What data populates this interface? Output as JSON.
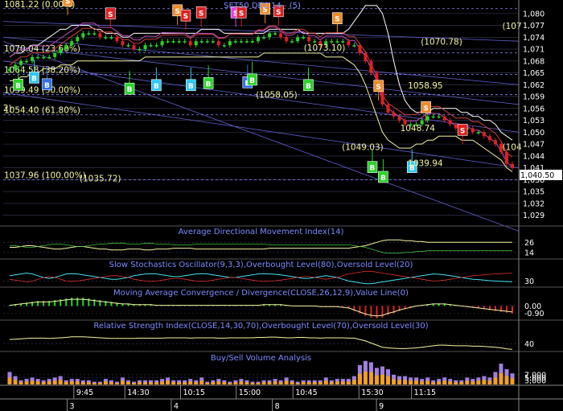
{
  "chart_data": {
    "type": "candlestick",
    "header": "SET50 DEC 14 - (5)",
    "last_price": "1,040.50",
    "price_ylim": [
      1026.5,
      1083
    ],
    "y_ticks": [
      "1,080",
      "1,077",
      "1,074",
      "1,071",
      "1,068",
      "1,065",
      "1,062",
      "1,059",
      "1,056",
      "1,053",
      "1,050",
      "1,047",
      "1,044",
      "1,041",
      "1,038",
      "1,035",
      "1,032",
      "1,029"
    ],
    "fib_levels": [
      {
        "label": "1081.22 (0.00%)",
        "value": 1081.22
      },
      {
        "label": "1070.04 (23.60%)",
        "value": 1070.04
      },
      {
        "label": "1064.58 (38.20%)",
        "value": 1064.58
      },
      {
        "label": "1059.49 (50.00%)",
        "value": 1059.49
      },
      {
        "label": "1054.40 (61.80%)",
        "value": 1054.4
      },
      {
        "label": "1037.96 (100.00%)",
        "value": 1037.96
      }
    ],
    "price_annotations": [
      {
        "label": "(1073.10)",
        "x": 0.583,
        "value": 1070.6
      },
      {
        "label": "(1070.78)",
        "x": 0.81,
        "value": 1072.1
      },
      {
        "label": "1058.95",
        "x": 0.785,
        "value": 1061.0
      },
      {
        "label": "(1058.05)",
        "x": 0.49,
        "value": 1058.7
      },
      {
        "label": "1048.74",
        "x": 0.77,
        "value": 1050.3
      },
      {
        "label": "(1049.03)",
        "x": 0.657,
        "value": 1045.5
      },
      {
        "label": "1039.94",
        "x": 0.785,
        "value": 1041.4
      },
      {
        "label": "(1035.72)",
        "x": 0.148,
        "value": 1037.6
      },
      {
        "label": "(104",
        "x": 0.968,
        "value": 1045.5
      },
      {
        "label": "(107",
        "x": 0.968,
        "value": 1076.1
      },
      {
        "label": "2)",
        "x": 0.0,
        "value": 1055.4
      }
    ],
    "signals": [
      {
        "t": "S",
        "x": 0.125,
        "value": 1083.3,
        "color": "#f08c28"
      },
      {
        "t": "S",
        "x": 0.208,
        "value": 1080.0,
        "color": "#e02020"
      },
      {
        "t": "S",
        "x": 0.338,
        "value": 1080.8,
        "color": "#f08c28"
      },
      {
        "t": "S",
        "x": 0.354,
        "value": 1079.5,
        "color": "#e02020"
      },
      {
        "t": "S",
        "x": 0.384,
        "value": 1080.3,
        "color": "#e02020"
      },
      {
        "t": "S",
        "x": 0.451,
        "value": 1080.3,
        "color": "#e040e0"
      },
      {
        "t": "S",
        "x": 0.462,
        "value": 1080.3,
        "color": "#e02020"
      },
      {
        "t": "S",
        "x": 0.508,
        "value": 1081.2,
        "color": "#f08c28"
      },
      {
        "t": "S",
        "x": 0.534,
        "value": 1080.6,
        "color": "#e02020"
      },
      {
        "t": "S",
        "x": 0.648,
        "value": 1078.8,
        "color": "#f08c28"
      },
      {
        "t": "S",
        "x": 0.728,
        "value": 1061.7,
        "color": "#f08c28"
      },
      {
        "t": "S",
        "x": 0.82,
        "value": 1056.3,
        "color": "#f08c28"
      },
      {
        "t": "S",
        "x": 0.891,
        "value": 1050.6,
        "color": "#e02020"
      },
      {
        "t": "B",
        "x": 0.029,
        "value": 1062.0,
        "color": "#28d428"
      },
      {
        "t": "B",
        "x": 0.06,
        "value": 1063.8,
        "color": "#2ec8f0"
      },
      {
        "t": "B",
        "x": 0.085,
        "value": 1062.1,
        "color": "#2e70e8"
      },
      {
        "t": "B",
        "x": 0.245,
        "value": 1061.0,
        "color": "#28d428"
      },
      {
        "t": "B",
        "x": 0.297,
        "value": 1061.9,
        "color": "#2ec8f0"
      },
      {
        "t": "B",
        "x": 0.364,
        "value": 1061.9,
        "color": "#2ec8f0"
      },
      {
        "t": "B",
        "x": 0.398,
        "value": 1062.4,
        "color": "#28d428"
      },
      {
        "t": "B",
        "x": 0.474,
        "value": 1062.6,
        "color": "#2e70e8"
      },
      {
        "t": "B",
        "x": 0.483,
        "value": 1063.3,
        "color": "#28d428"
      },
      {
        "t": "B",
        "x": 0.592,
        "value": 1061.9,
        "color": "#28d428"
      },
      {
        "t": "B",
        "x": 0.716,
        "value": 1041.2,
        "color": "#28d428"
      },
      {
        "t": "B",
        "x": 0.737,
        "value": 1038.7,
        "color": "#28d428"
      },
      {
        "t": "B",
        "x": 0.793,
        "value": 1041.2,
        "color": "#2ec8f0"
      }
    ],
    "close_series": [
      1066,
      1067,
      1068,
      1068,
      1069,
      1069,
      1069,
      1069,
      1070,
      1071,
      1072,
      1073,
      1074,
      1075,
      1075,
      1075,
      1074,
      1074,
      1074,
      1073,
      1072,
      1072,
      1071,
      1071,
      1072,
      1072,
      1072,
      1073,
      1073,
      1073,
      1073,
      1073,
      1072,
      1073,
      1073,
      1073,
      1073,
      1072,
      1072,
      1073,
      1073,
      1073,
      1073,
      1073,
      1074,
      1074,
      1075,
      1075,
      1074,
      1073,
      1073,
      1074,
      1074,
      1073,
      1073,
      1072,
      1073,
      1073,
      1073,
      1073,
      1072,
      1072,
      1070,
      1068,
      1065,
      1062,
      1057,
      1055,
      1054,
      1053,
      1052,
      1052,
      1052,
      1053,
      1054,
      1054,
      1054,
      1053,
      1052,
      1051,
      1051,
      1051,
      1050,
      1050,
      1049,
      1048,
      1047,
      1045,
      1042,
      1041
    ],
    "fast_band": [
      1069,
      1070,
      1070,
      1071,
      1072,
      1072,
      1073,
      1074,
      1075,
      1076,
      1076,
      1077,
      1077,
      1077,
      1077,
      1076,
      1076,
      1075,
      1075,
      1075,
      1074,
      1074,
      1075,
      1075,
      1075,
      1075,
      1075,
      1075,
      1075,
      1075,
      1075,
      1075,
      1075,
      1075,
      1076,
      1076,
      1076,
      1076,
      1075,
      1075,
      1075,
      1075,
      1075,
      1075,
      1075,
      1075,
      1076,
      1076,
      1076,
      1076,
      1076,
      1076,
      1075,
      1075,
      1075,
      1075,
      1075,
      1075,
      1075,
      1075,
      1076,
      1078,
      1080,
      1082,
      1082,
      1082,
      1080,
      1075,
      1068,
      1062,
      1058,
      1056,
      1055,
      1055,
      1055,
      1056,
      1056,
      1056,
      1056,
      1056,
      1055,
      1055,
      1054,
      1054,
      1053,
      1053,
      1052,
      1050,
      1049,
      1048
    ],
    "slow_band": [
      1063,
      1063,
      1064,
      1064,
      1065,
      1065,
      1066,
      1066,
      1066,
      1067,
      1067,
      1067,
      1068,
      1068,
      1068,
      1068,
      1068,
      1068,
      1068,
      1068,
      1068,
      1068,
      1068,
      1068,
      1069,
      1069,
      1069,
      1069,
      1069,
      1069,
      1069,
      1069,
      1069,
      1069,
      1069,
      1069,
      1069,
      1069,
      1069,
      1069,
      1069,
      1069,
      1069,
      1069,
      1069,
      1070,
      1070,
      1070,
      1070,
      1070,
      1070,
      1070,
      1070,
      1070,
      1070,
      1070,
      1069,
      1069,
      1069,
      1069,
      1068,
      1067,
      1065,
      1062,
      1058,
      1054,
      1050,
      1048,
      1047,
      1046,
      1046,
      1046,
      1047,
      1047,
      1048,
      1048,
      1049,
      1049,
      1049,
      1049,
      1048,
      1048,
      1048,
      1047,
      1046,
      1045,
      1044,
      1043,
      1041,
      1040
    ],
    "indicator_titles": [
      "Average Directional Movement Index(14)",
      "Slow Stochastics Oscillator(9,3,3),Overbought Level(80),Oversold Level(20)",
      "Moving Average Convergence / Divergence(CLOSE,26,12,9),Value Line(0)",
      "Relative Strength Index(CLOSE,14,30,70),Overbought Level(70),Oversold Level(30)",
      "Buy/Sell Volume Analysis"
    ],
    "adx_ticks": [
      "26",
      "14"
    ],
    "stoch_ticks": [
      "30"
    ],
    "macd_ticks": [
      "0.00",
      "-0.90"
    ],
    "rsi_ticks": [
      "40"
    ],
    "volume_ticks": [
      "7,000",
      "5,000",
      "3,000"
    ],
    "adx": [
      20,
      20,
      21,
      22,
      22,
      21,
      20,
      19,
      18,
      18,
      19,
      20,
      21,
      21,
      20,
      19,
      18,
      18,
      17,
      17,
      17,
      18,
      18,
      18,
      17,
      17,
      18,
      18,
      18,
      19,
      19,
      19,
      19,
      18,
      18,
      18,
      18,
      18,
      18,
      18,
      18,
      18,
      18,
      18,
      18,
      18,
      19,
      19,
      19,
      19,
      19,
      19,
      19,
      19,
      19,
      19,
      19,
      19,
      19,
      19,
      19,
      20,
      21,
      22,
      24,
      26,
      28,
      29,
      29,
      29,
      28,
      28,
      27,
      27,
      26,
      26,
      26,
      26,
      26,
      26,
      26,
      26,
      26,
      26,
      26,
      26,
      26,
      26,
      26,
      26
    ],
    "stoch_k": [
      60,
      65,
      70,
      75,
      70,
      60,
      50,
      45,
      50,
      60,
      70,
      72,
      70,
      65,
      60,
      55,
      50,
      45,
      40,
      40,
      45,
      50,
      60,
      65,
      70,
      72,
      70,
      65,
      60,
      55,
      55,
      60,
      65,
      70,
      72,
      70,
      65,
      60,
      55,
      50,
      50,
      55,
      60,
      65,
      70,
      72,
      70,
      68,
      65,
      60,
      55,
      50,
      45,
      45,
      50,
      55,
      60,
      55,
      50,
      40,
      30,
      25,
      20,
      15,
      15,
      20,
      25,
      30,
      35,
      40,
      45,
      50,
      55,
      60,
      65,
      70,
      68,
      65,
      60,
      55,
      50,
      45,
      40,
      38,
      35,
      32,
      30,
      28,
      27,
      26
    ],
    "macd_hist": [
      0.1,
      0.2,
      0.3,
      0.4,
      0.5,
      0.6,
      0.6,
      0.6,
      0.7,
      0.8,
      0.9,
      1.0,
      1.0,
      1.0,
      0.9,
      0.8,
      0.7,
      0.6,
      0.5,
      0.4,
      0.3,
      0.3,
      0.2,
      0.2,
      0.2,
      0.2,
      0.1,
      0.1,
      0.1,
      0.1,
      0.1,
      0.1,
      0.1,
      0.1,
      0.1,
      0.1,
      0.1,
      0.1,
      0.1,
      0.1,
      0.1,
      0.1,
      0.1,
      0.1,
      0.1,
      0.2,
      0.2,
      0.2,
      0.2,
      0.1,
      0.0,
      0.0,
      0.0,
      0.0,
      0.0,
      -0.1,
      -0.1,
      -0.1,
      -0.1,
      -0.2,
      -0.3,
      -0.6,
      -0.9,
      -1.2,
      -1.4,
      -1.5,
      -1.4,
      -1.1,
      -0.9,
      -0.6,
      -0.4,
      -0.2,
      0.0,
      0.1,
      0.2,
      0.3,
      0.3,
      0.3,
      0.2,
      0.1,
      0.0,
      -0.1,
      -0.2,
      -0.3,
      -0.4,
      -0.5,
      -0.6,
      -0.7,
      -0.8,
      -0.9
    ],
    "rsi": [
      52,
      53,
      54,
      55,
      56,
      56,
      56,
      55,
      56,
      57,
      58,
      60,
      60,
      60,
      59,
      58,
      57,
      56,
      55,
      55,
      55,
      55,
      55,
      56,
      56,
      56,
      56,
      56,
      57,
      57,
      57,
      57,
      56,
      57,
      57,
      57,
      57,
      56,
      56,
      57,
      57,
      57,
      57,
      57,
      58,
      58,
      59,
      59,
      58,
      57,
      57,
      58,
      58,
      57,
      57,
      56,
      57,
      57,
      57,
      57,
      56,
      56,
      52,
      48,
      42,
      36,
      30,
      28,
      27,
      26,
      26,
      27,
      28,
      30,
      32,
      34,
      36,
      36,
      35,
      34,
      34,
      34,
      33,
      33,
      32,
      31,
      30,
      28,
      25,
      24
    ],
    "volume": [
      9,
      6,
      3,
      4,
      5,
      4,
      3,
      4,
      5,
      6,
      3,
      4,
      4,
      3,
      3,
      2,
      2,
      4,
      3,
      2,
      5,
      3,
      2,
      3,
      3,
      3,
      3,
      4,
      5,
      3,
      3,
      3,
      4,
      3,
      5,
      2,
      3,
      4,
      3,
      2,
      3,
      4,
      3,
      2,
      2,
      3,
      3,
      4,
      3,
      5,
      3,
      2,
      3,
      3,
      3,
      3,
      5,
      3,
      4,
      4,
      4,
      6,
      14,
      17,
      16,
      12,
      13,
      11,
      7,
      6,
      6,
      5,
      5,
      4,
      5,
      3,
      4,
      5,
      4,
      3,
      3,
      5,
      4,
      5,
      6,
      5,
      9,
      15,
      11,
      8
    ],
    "x_ticks": [
      {
        "label": "9:45",
        "x": 0.137
      },
      {
        "label": "14:30",
        "x": 0.236
      },
      {
        "label": "10:15",
        "x": 0.344
      },
      {
        "label": "15:00",
        "x": 0.452
      },
      {
        "label": "10:45",
        "x": 0.562
      },
      {
        "label": "15:30",
        "x": 0.69
      },
      {
        "label": "11:15",
        "x": 0.792
      }
    ],
    "day_ticks": [
      {
        "label": "3",
        "x": 0.124
      },
      {
        "label": "4",
        "x": 0.326
      },
      {
        "label": "8",
        "x": 0.522
      },
      {
        "label": "9",
        "x": 0.724
      }
    ]
  },
  "colors": {
    "bull": "#28d428",
    "bear": "#e02020",
    "grid": "#3c3c5c",
    "band1": "#f5f5a0",
    "band2": "#ffffff",
    "ma1": "#c050c0",
    "ma2": "#d04040",
    "fib": "#5050f0"
  }
}
